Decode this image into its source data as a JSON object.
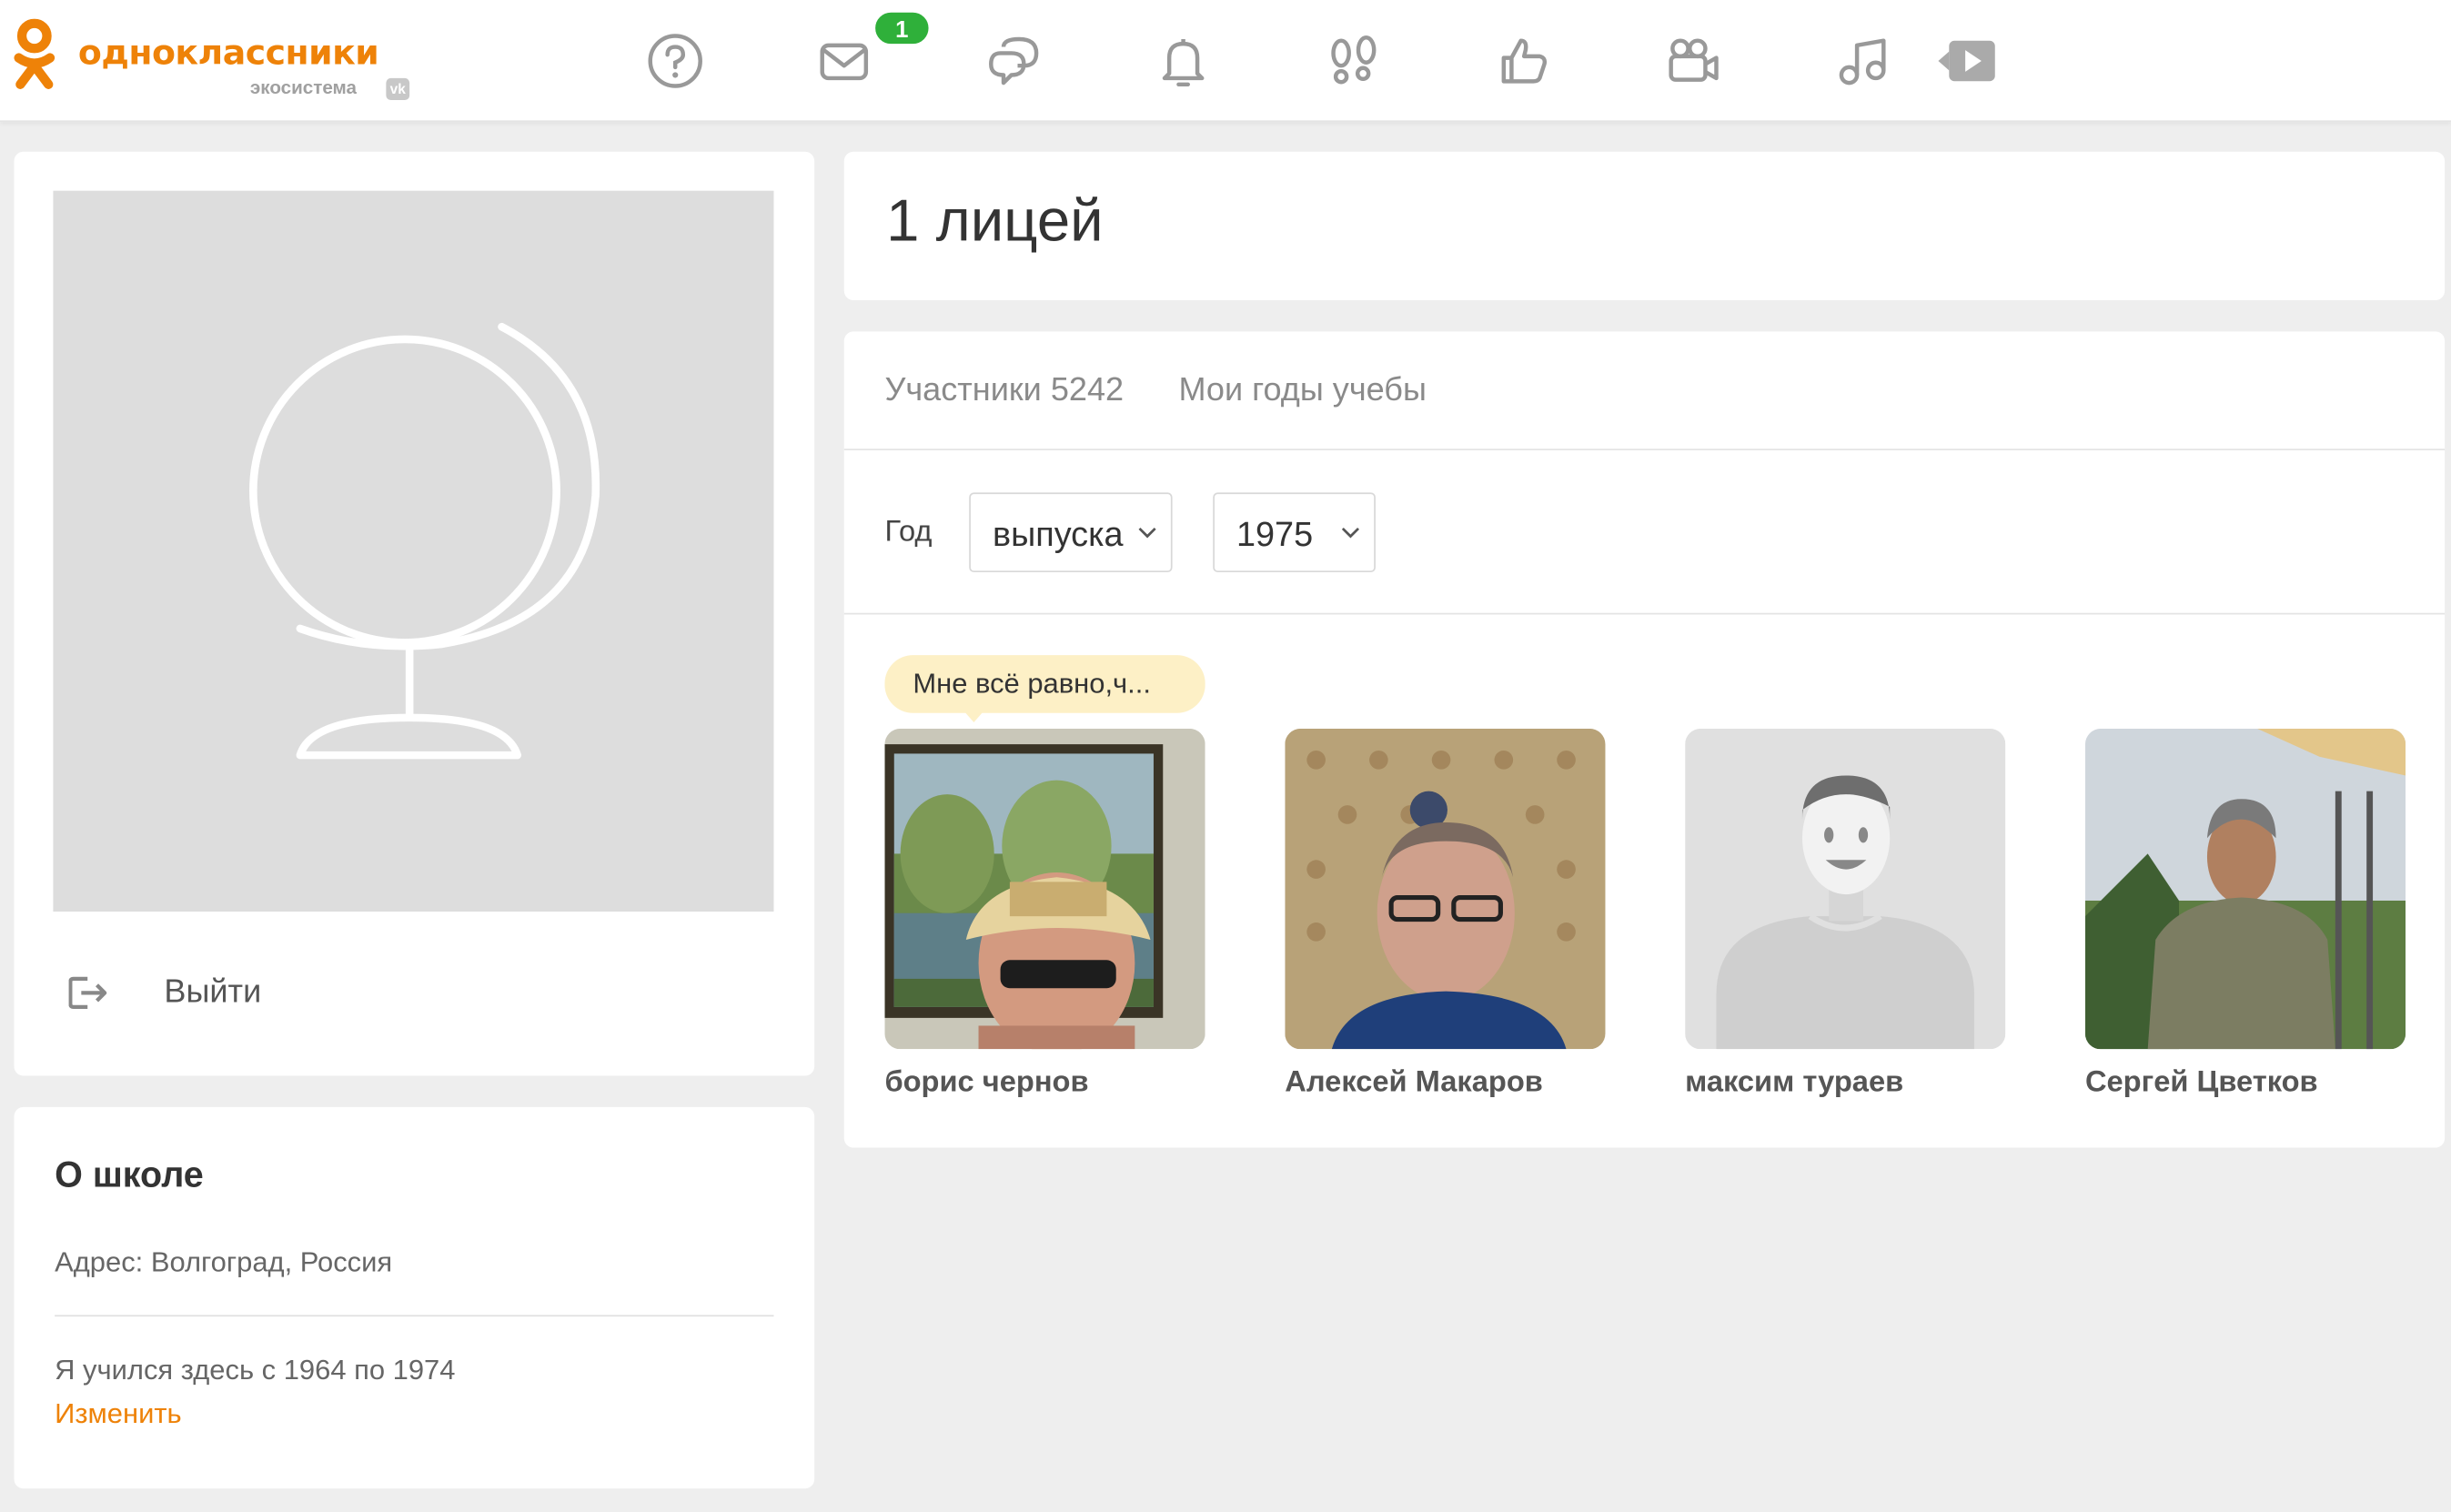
{
  "brand": {
    "name": "одноклассники",
    "sub": "экосистема",
    "vk": "vk",
    "color": "#ee8208"
  },
  "topnav": {
    "icons": [
      "help-icon",
      "mail-icon",
      "chat-icon",
      "bell-icon",
      "footprints-icon",
      "like-icon",
      "video-camera-icon",
      "music-icon",
      "play-icon"
    ],
    "mail_badge": "1",
    "badge_color": "#2fb03a"
  },
  "left": {
    "logout_label": "Выйти"
  },
  "school": {
    "title": "О школе",
    "address": "Адрес: Волгоград, Россия",
    "years": "Я учился здесь с 1964 по 1974",
    "edit_label": "Изменить"
  },
  "page": {
    "title": "1 лицей"
  },
  "tabs": {
    "members": "Участники 5242",
    "my_years": "Мои годы учебы"
  },
  "filter": {
    "year_label": "Год",
    "type_value": "выпуска",
    "year_value": "1975"
  },
  "status": {
    "text": "Мне всё равно,ч..."
  },
  "members": [
    {
      "name": "борис чернов"
    },
    {
      "name": "Алексей Макаров"
    },
    {
      "name": "максим тураев"
    },
    {
      "name": "Сергей Цветков"
    }
  ]
}
